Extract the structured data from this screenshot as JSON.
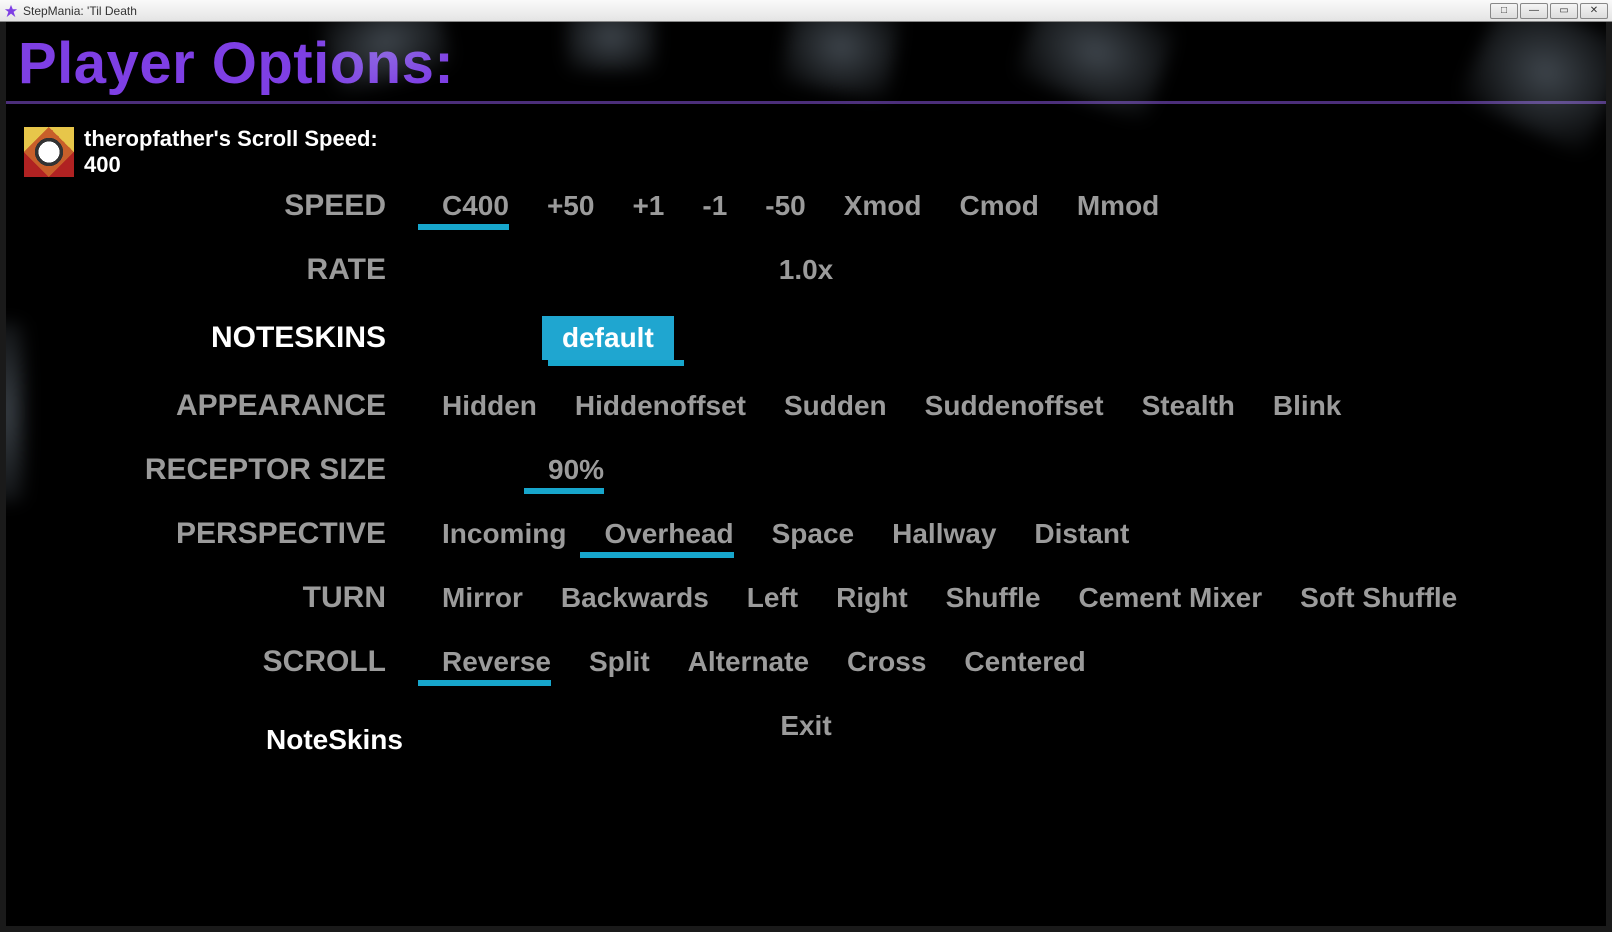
{
  "window": {
    "title": "StepMania: 'Til Death",
    "buttons": {
      "ghost": "□",
      "min": "—",
      "max": "▭",
      "close": "✕"
    }
  },
  "page": {
    "title": "Player Options:"
  },
  "player": {
    "name_line": "theropfather's Scroll Speed:",
    "speed_value": "400"
  },
  "rows": [
    {
      "id": "speed",
      "label": "SPEED",
      "selectedRow": false,
      "center": false,
      "options": [
        {
          "id": "c400",
          "text": "C400",
          "underlined": true,
          "shiftLeft": true,
          "boxed": false
        },
        {
          "id": "p50",
          "text": "+50",
          "underlined": false,
          "shiftLeft": false,
          "boxed": false
        },
        {
          "id": "p1",
          "text": "+1",
          "underlined": false,
          "shiftLeft": false,
          "boxed": false
        },
        {
          "id": "m1",
          "text": "-1",
          "underlined": false,
          "shiftLeft": false,
          "boxed": false
        },
        {
          "id": "m50",
          "text": "-50",
          "underlined": false,
          "shiftLeft": false,
          "boxed": false
        },
        {
          "id": "xmod",
          "text": "Xmod",
          "underlined": false,
          "shiftLeft": false,
          "boxed": false
        },
        {
          "id": "cmod",
          "text": "Cmod",
          "underlined": false,
          "shiftLeft": false,
          "boxed": false
        },
        {
          "id": "mmod",
          "text": "Mmod",
          "underlined": false,
          "shiftLeft": false,
          "boxed": false
        }
      ]
    },
    {
      "id": "rate",
      "label": "RATE",
      "selectedRow": false,
      "center": true,
      "options": [
        {
          "id": "rate1",
          "text": "1.0x",
          "underlined": false,
          "shiftLeft": false,
          "boxed": false
        }
      ]
    },
    {
      "id": "noteskins",
      "label": "NOTESKINS",
      "selectedRow": true,
      "center": false,
      "options": [
        {
          "id": "default",
          "text": "default",
          "underlined": false,
          "shiftLeft": false,
          "boxed": true
        }
      ]
    },
    {
      "id": "appearance",
      "label": "APPEARANCE",
      "selectedRow": false,
      "center": false,
      "options": [
        {
          "id": "hidden",
          "text": "Hidden",
          "underlined": false,
          "shiftLeft": false,
          "boxed": false
        },
        {
          "id": "hiddenoffset",
          "text": "Hiddenoffset",
          "underlined": false,
          "shiftLeft": false,
          "boxed": false
        },
        {
          "id": "sudden",
          "text": "Sudden",
          "underlined": false,
          "shiftLeft": false,
          "boxed": false
        },
        {
          "id": "suddenoffset",
          "text": "Suddenoffset",
          "underlined": false,
          "shiftLeft": false,
          "boxed": false
        },
        {
          "id": "stealth",
          "text": "Stealth",
          "underlined": false,
          "shiftLeft": false,
          "boxed": false
        },
        {
          "id": "blink",
          "text": "Blink",
          "underlined": false,
          "shiftLeft": false,
          "boxed": false
        }
      ]
    },
    {
      "id": "receptor",
      "label": "RECEPTOR SIZE",
      "selectedRow": false,
      "center": false,
      "options": [
        {
          "id": "r90",
          "text": "90%",
          "underlined": true,
          "shiftLeft": true,
          "boxed": false
        }
      ]
    },
    {
      "id": "perspective",
      "label": "PERSPECTIVE",
      "selectedRow": false,
      "center": false,
      "options": [
        {
          "id": "incoming",
          "text": "Incoming",
          "underlined": false,
          "shiftLeft": false,
          "boxed": false
        },
        {
          "id": "overhead",
          "text": "Overhead",
          "underlined": true,
          "shiftLeft": true,
          "boxed": false
        },
        {
          "id": "space",
          "text": "Space",
          "underlined": false,
          "shiftLeft": false,
          "boxed": false
        },
        {
          "id": "hallway",
          "text": "Hallway",
          "underlined": false,
          "shiftLeft": false,
          "boxed": false
        },
        {
          "id": "distant",
          "text": "Distant",
          "underlined": false,
          "shiftLeft": false,
          "boxed": false
        }
      ]
    },
    {
      "id": "turn",
      "label": "TURN",
      "selectedRow": false,
      "center": false,
      "options": [
        {
          "id": "mirror",
          "text": "Mirror",
          "underlined": false,
          "shiftLeft": false,
          "boxed": false
        },
        {
          "id": "backwards",
          "text": "Backwards",
          "underlined": false,
          "shiftLeft": false,
          "boxed": false
        },
        {
          "id": "left",
          "text": "Left",
          "underlined": false,
          "shiftLeft": false,
          "boxed": false
        },
        {
          "id": "right",
          "text": "Right",
          "underlined": false,
          "shiftLeft": false,
          "boxed": false
        },
        {
          "id": "shuffle",
          "text": "Shuffle",
          "underlined": false,
          "shiftLeft": false,
          "boxed": false
        },
        {
          "id": "cement",
          "text": "Cement Mixer",
          "underlined": false,
          "shiftLeft": false,
          "boxed": false
        },
        {
          "id": "softshuffle",
          "text": "Soft Shuffle",
          "underlined": false,
          "shiftLeft": false,
          "boxed": false
        }
      ]
    },
    {
      "id": "scroll",
      "label": "SCROLL",
      "selectedRow": false,
      "center": false,
      "options": [
        {
          "id": "reverse",
          "text": "Reverse",
          "underlined": true,
          "shiftLeft": true,
          "boxed": false
        },
        {
          "id": "split",
          "text": "Split",
          "underlined": false,
          "shiftLeft": false,
          "boxed": false
        },
        {
          "id": "alternate",
          "text": "Alternate",
          "underlined": false,
          "shiftLeft": false,
          "boxed": false
        },
        {
          "id": "cross",
          "text": "Cross",
          "underlined": false,
          "shiftLeft": false,
          "boxed": false
        },
        {
          "id": "centered",
          "text": "Centered",
          "underlined": false,
          "shiftLeft": false,
          "boxed": false
        }
      ]
    }
  ],
  "exit": {
    "label": "Exit"
  },
  "footer": {
    "label": "NoteSkins"
  }
}
